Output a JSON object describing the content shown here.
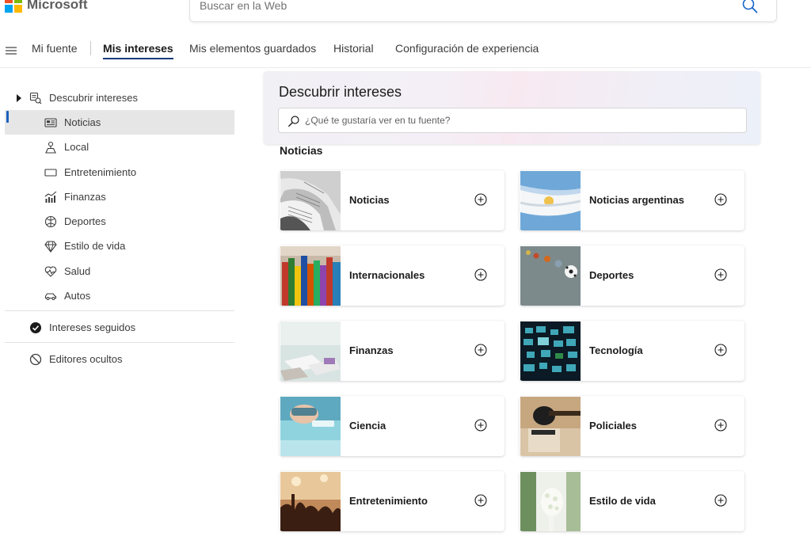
{
  "brand": {
    "name": "Microsoft",
    "colors": [
      "#f25022",
      "#7fba00",
      "#00a4ef",
      "#ffb900"
    ]
  },
  "web_search": {
    "placeholder": "Buscar en la Web",
    "icon": "search-icon"
  },
  "nav": {
    "menu_icon": "hamburger-icon",
    "items": [
      {
        "label": "Mi fuente"
      },
      {
        "label": "Mis intereses",
        "active": true
      },
      {
        "label": "Mis elementos guardados"
      },
      {
        "label": "Historial"
      },
      {
        "label": "Configuración de experiencia"
      }
    ]
  },
  "sidebar": {
    "discover": {
      "label": "Descubrir intereses",
      "icon": "discover-icon",
      "caret": "caret-right-icon"
    },
    "categories": [
      {
        "label": "Noticias",
        "icon": "newspaper-icon",
        "active": true
      },
      {
        "label": "Local",
        "icon": "location-icon"
      },
      {
        "label": "Entretenimiento",
        "icon": "ticket-icon"
      },
      {
        "label": "Finanzas",
        "icon": "finance-chart-icon"
      },
      {
        "label": "Deportes",
        "icon": "ball-icon"
      },
      {
        "label": "Estilo de vida",
        "icon": "diamond-icon"
      },
      {
        "label": "Salud",
        "icon": "heart-pulse-icon"
      },
      {
        "label": "Autos",
        "icon": "car-icon"
      }
    ],
    "followed": {
      "label": "Intereses seguidos",
      "icon": "check-circle-icon"
    },
    "hidden": {
      "label": "Editores ocultos",
      "icon": "block-icon"
    }
  },
  "discover_panel": {
    "title": "Descubrir intereses",
    "search_placeholder": "¿Qué te gustaría ver en tu fuente?"
  },
  "section": {
    "title": "Noticias"
  },
  "cards": [
    {
      "title": "Noticias",
      "image": "newspapers"
    },
    {
      "title": "Noticias argentinas",
      "image": "argentina-flag"
    },
    {
      "title": "Internacionales",
      "image": "flags"
    },
    {
      "title": "Deportes",
      "image": "sports-balls"
    },
    {
      "title": "Finanzas",
      "image": "documents-desk"
    },
    {
      "title": "Tecnología",
      "image": "screens"
    },
    {
      "title": "Ciencia",
      "image": "lab-scientist"
    },
    {
      "title": "Policiales",
      "image": "gavel"
    },
    {
      "title": "Entretenimiento",
      "image": "concert-crowd"
    },
    {
      "title": "Estilo de vida",
      "image": "wedding-flowers"
    }
  ]
}
